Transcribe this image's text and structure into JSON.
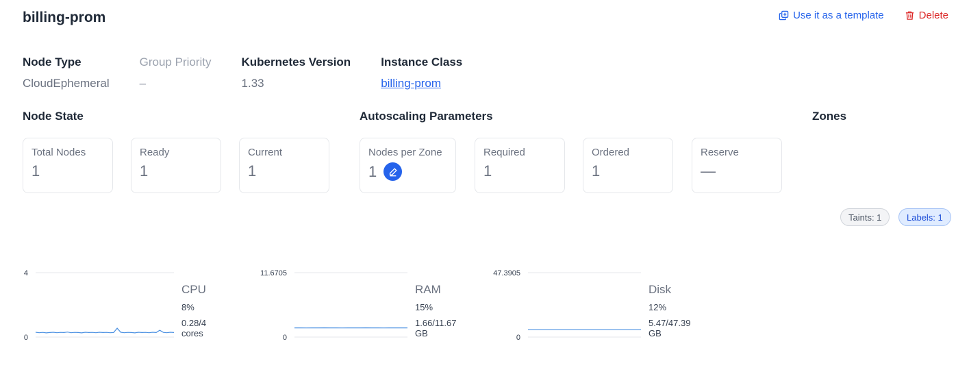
{
  "header": {
    "title": "billing-prom",
    "template_label": "Use it as a template",
    "delete_label": "Delete"
  },
  "properties": [
    {
      "label": "Node Type",
      "value": "CloudEphemeral"
    },
    {
      "label": "Group Priority",
      "value": "–"
    },
    {
      "label": "Kubernetes Version",
      "value": "1.33"
    },
    {
      "label": "Instance Class",
      "value": "billing-prom"
    }
  ],
  "node_state": {
    "title": "Node State",
    "cards": [
      {
        "label": "Total Nodes",
        "value": "1"
      },
      {
        "label": "Ready",
        "value": "1"
      },
      {
        "label": "Current",
        "value": "1"
      }
    ]
  },
  "autoscaling": {
    "title": "Autoscaling Parameters",
    "cards": [
      {
        "label": "Nodes per Zone",
        "value": "1"
      },
      {
        "label": "Required",
        "value": "1"
      },
      {
        "label": "Ordered",
        "value": "1"
      },
      {
        "label": "Reserve",
        "value": "—"
      }
    ]
  },
  "zones": {
    "title": "Zones"
  },
  "badges": {
    "taints": "Taints: 1",
    "labels": "Labels: 1"
  },
  "colors": {
    "accent": "#2563eb",
    "danger": "#dc2626",
    "series": "#4a90e2"
  },
  "metrics": [
    {
      "name": "CPU",
      "percent": "8%",
      "absolute": "0.28/4 cores",
      "chart_data": {
        "type": "line",
        "ylim": [
          0,
          4
        ],
        "ytick_labels": [
          "0",
          "4"
        ],
        "values": [
          0.3,
          0.27,
          0.29,
          0.26,
          0.28,
          0.3,
          0.27,
          0.29,
          0.28,
          0.31,
          0.27,
          0.29,
          0.28,
          0.26,
          0.3,
          0.28,
          0.29,
          0.27,
          0.3,
          0.28,
          0.29,
          0.27,
          0.28,
          0.55,
          0.3,
          0.27,
          0.29,
          0.28,
          0.26,
          0.3,
          0.28,
          0.29,
          0.27,
          0.3,
          0.28,
          0.42,
          0.29,
          0.27,
          0.3,
          0.28
        ]
      }
    },
    {
      "name": "RAM",
      "percent": "15%",
      "absolute": "1.66/11.67 GB",
      "chart_data": {
        "type": "line",
        "ylim": [
          0,
          11.6705
        ],
        "ytick_labels": [
          "0",
          "11.6705"
        ],
        "values": [
          1.66,
          1.66,
          1.65,
          1.66,
          1.66,
          1.67,
          1.66,
          1.66,
          1.65,
          1.66,
          1.66,
          1.66,
          1.67,
          1.66,
          1.66,
          1.65,
          1.66,
          1.66,
          1.66,
          1.66
        ]
      }
    },
    {
      "name": "Disk",
      "percent": "12%",
      "absolute": "5.47/47.39 GB",
      "chart_data": {
        "type": "line",
        "ylim": [
          0,
          47.3905
        ],
        "ytick_labels": [
          "0",
          "47.3905"
        ],
        "values": [
          5.47,
          5.47,
          5.47,
          5.47,
          5.47,
          5.47,
          5.47,
          5.47,
          5.47,
          5.47,
          5.47,
          5.47,
          5.47,
          5.47,
          5.47,
          5.47,
          5.47,
          5.47,
          5.47,
          5.47
        ]
      }
    }
  ]
}
